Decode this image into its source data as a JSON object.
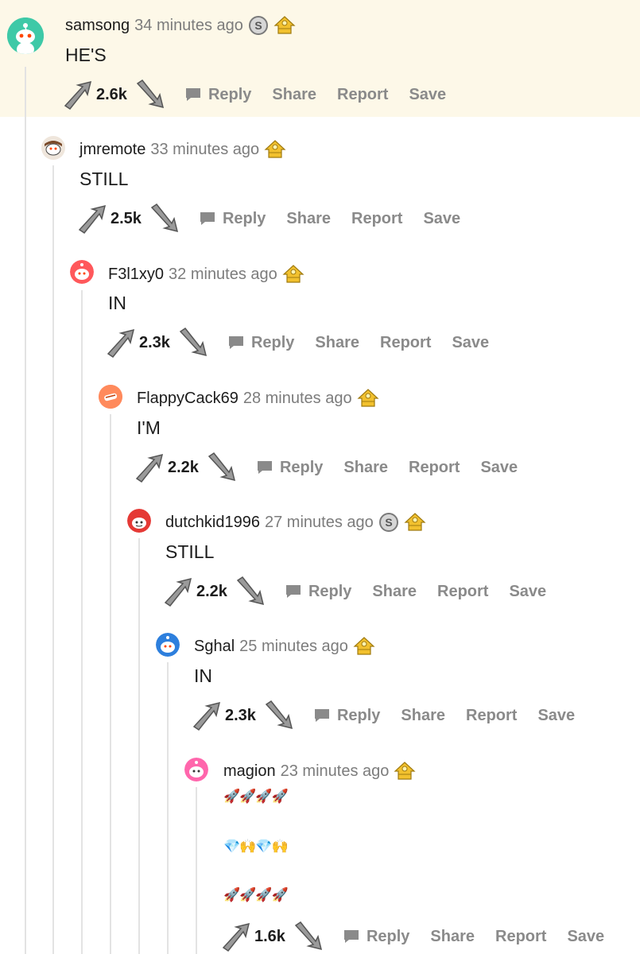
{
  "colors": {
    "highlight": "#fdf8e8",
    "thread_line": "#e3e3e3",
    "muted_text": "#7c7c7c",
    "action_text": "#8a8a8a",
    "silver_award": "#9a9a9a",
    "gold_award": "#e8b820"
  },
  "actions": {
    "reply": "Reply",
    "share": "Share",
    "report": "Report",
    "save": "Save"
  },
  "comments": [
    {
      "username": "samsong",
      "timestamp": "34 minutes ago",
      "awards": [
        "silver-award-icon",
        "gold-award-icon"
      ],
      "body": "HE'S",
      "score": "2.6k",
      "highlighted": true
    },
    {
      "username": "jmremote",
      "timestamp": "33 minutes ago",
      "awards": [
        "gold-award-icon"
      ],
      "body": "STILL",
      "score": "2.5k"
    },
    {
      "username": "F3l1xy0",
      "timestamp": "32 minutes ago",
      "awards": [
        "gold-award-icon"
      ],
      "body": "IN",
      "score": "2.3k"
    },
    {
      "username": "FlappyCack69",
      "timestamp": "28 minutes ago",
      "awards": [
        "gold-award-icon"
      ],
      "body": "I'M",
      "score": "2.2k"
    },
    {
      "username": "dutchkid1996",
      "timestamp": "27 minutes ago",
      "awards": [
        "silver-award-icon",
        "gold-award-icon"
      ],
      "body": "STILL",
      "score": "2.2k"
    },
    {
      "username": "Sghal",
      "timestamp": "25 minutes ago",
      "awards": [
        "gold-award-icon"
      ],
      "body": "IN",
      "score": "2.3k"
    },
    {
      "username": "magion",
      "timestamp": "23 minutes ago",
      "awards": [
        "gold-award-icon"
      ],
      "body_lines": [
        "🚀🚀🚀🚀",
        "💎🙌💎🙌",
        "🚀🚀🚀🚀"
      ],
      "score": "1.6k"
    }
  ]
}
